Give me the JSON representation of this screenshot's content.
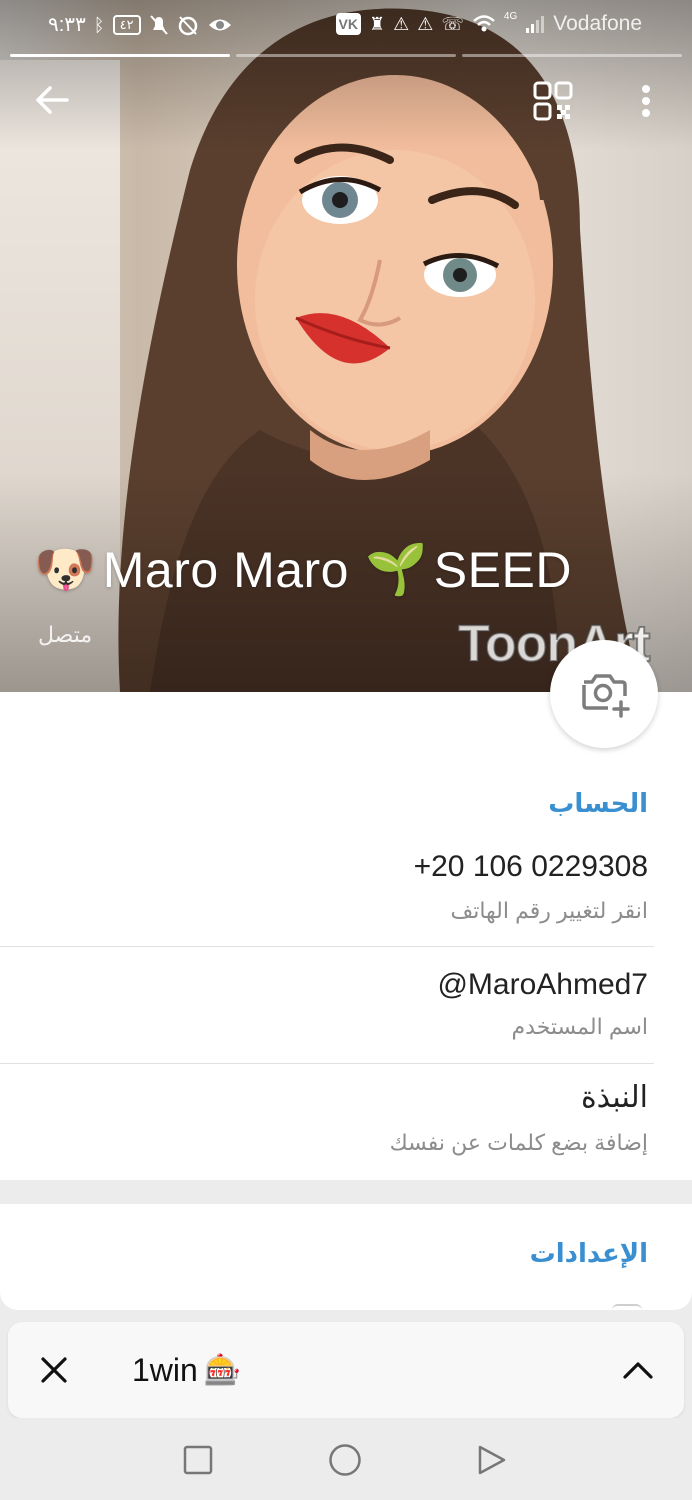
{
  "status_bar": {
    "time": "٩:٣٣",
    "battery": "٤٢",
    "network": "4G",
    "carrier": "Vodafone"
  },
  "toolbar": {
    "back_icon": "arrow-left-icon",
    "qr_icon": "qr-code-icon",
    "more_icon": "more-vertical-icon"
  },
  "profile": {
    "name": "Maro Maro",
    "name_prefix_emoji": "🐶",
    "name_suffix_emoji": "🌱",
    "badge": "SEED",
    "status": "متصل",
    "watermark": "ToonArt"
  },
  "account": {
    "section_title": "الحساب",
    "phone": "+20 106 0229308",
    "phone_hint": "انقر لتغيير رقم الهاتف",
    "username": "@MaroAhmed7",
    "username_label": "اسم المستخدم",
    "bio_title": "النبذة",
    "bio_hint": "إضافة بضع كلمات عن نفسك"
  },
  "settings": {
    "section_title": "الإعدادات"
  },
  "banner": {
    "title": "1win",
    "emoji": "🎰"
  },
  "colors": {
    "accent": "#3a8fd1",
    "background": "#ececec"
  }
}
